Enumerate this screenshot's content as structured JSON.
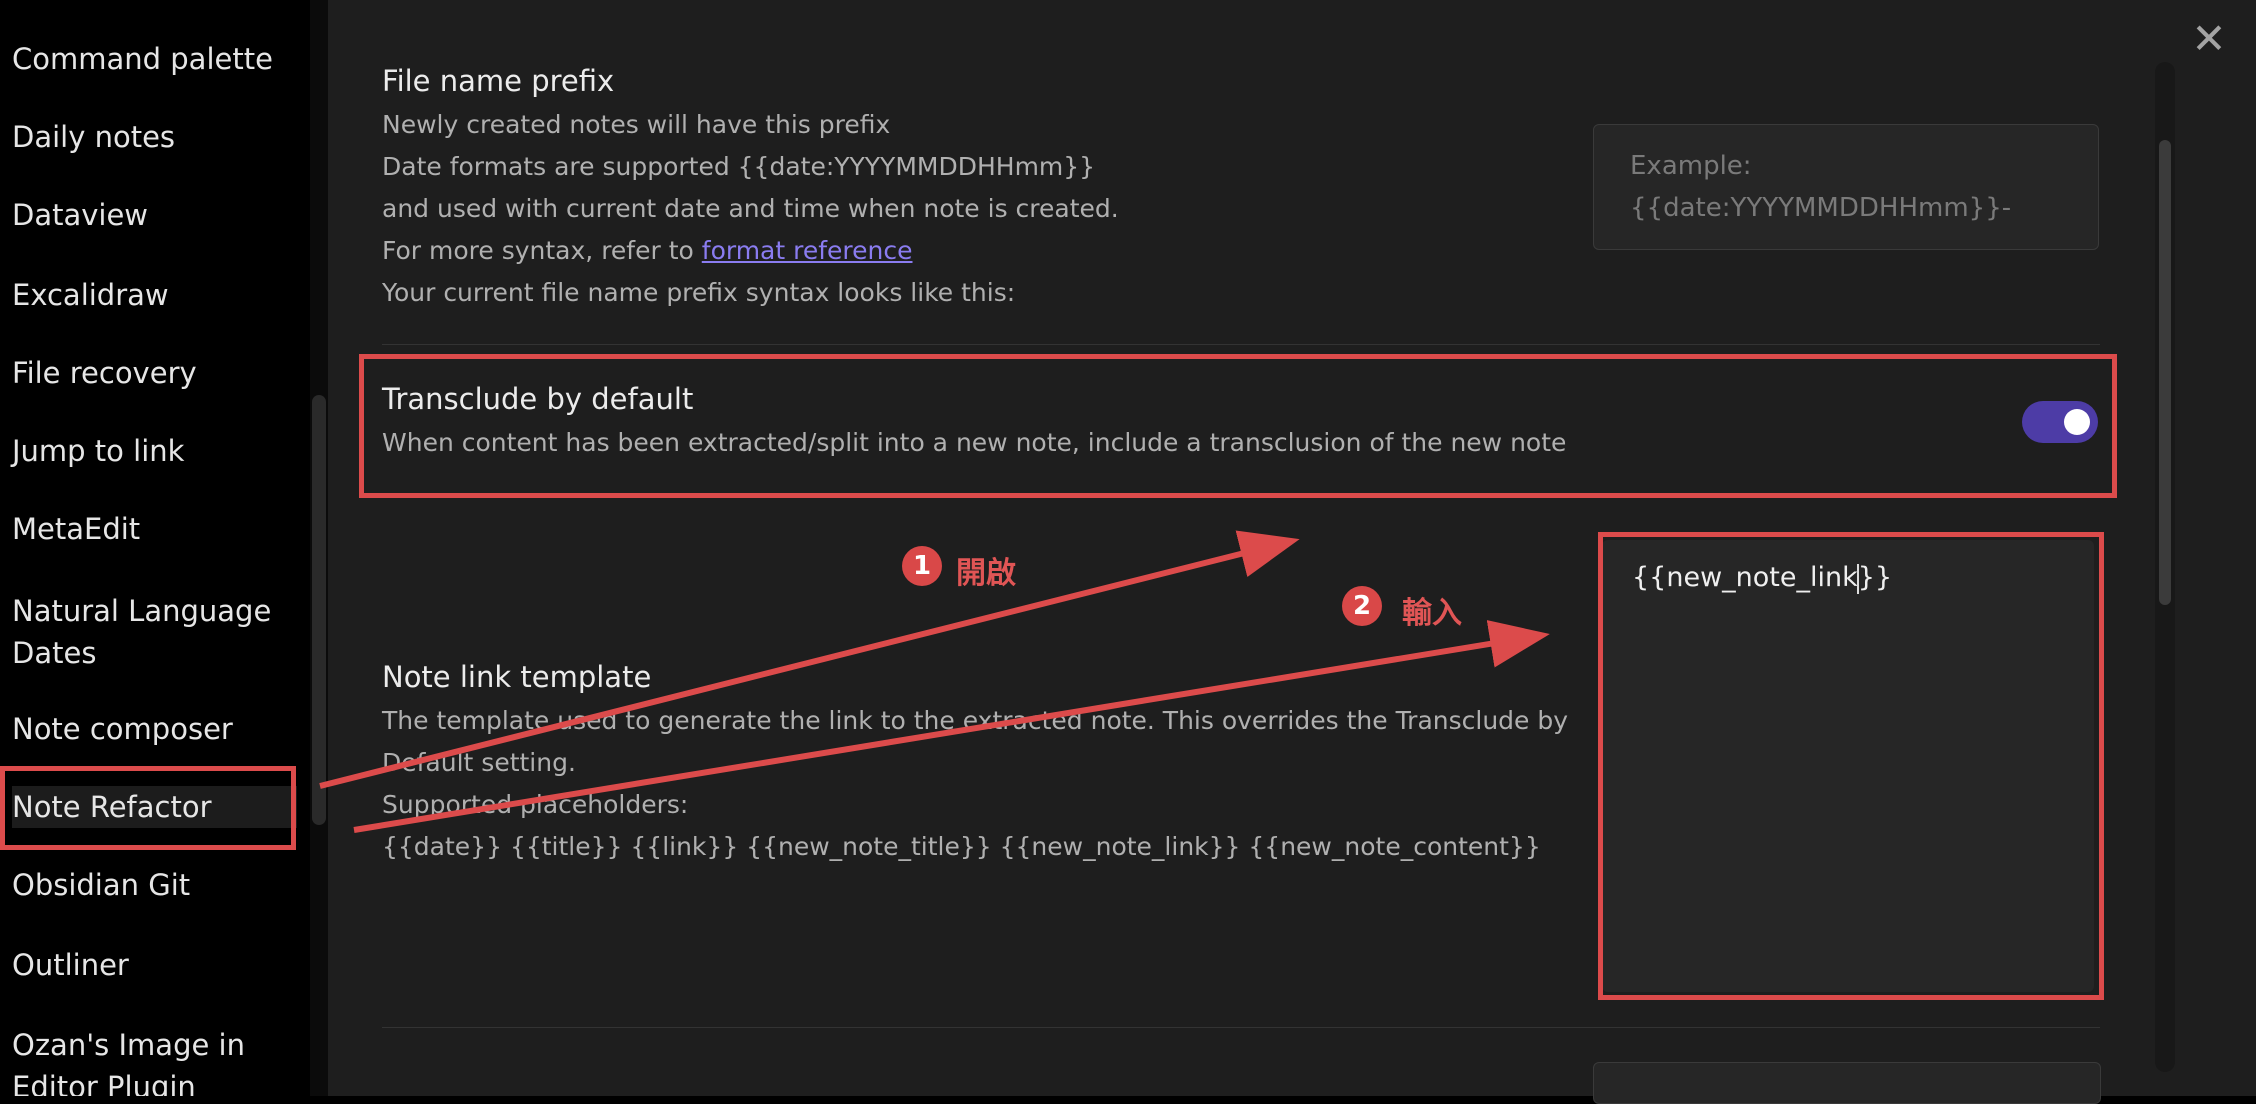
{
  "sidebar": {
    "items": [
      {
        "label": "Command palette"
      },
      {
        "label": "Daily notes"
      },
      {
        "label": "Dataview"
      },
      {
        "label": "Excalidraw"
      },
      {
        "label": "File recovery"
      },
      {
        "label": "Jump to link"
      },
      {
        "label": "MetaEdit"
      },
      {
        "label": "Natural Language Dates"
      },
      {
        "label": "Note composer"
      },
      {
        "label": "Note Refactor"
      },
      {
        "label": "Obsidian Git"
      },
      {
        "label": "Outliner"
      },
      {
        "label": "Ozan's Image in Editor Plugin"
      }
    ]
  },
  "settings": {
    "file_name_prefix": {
      "name": "File name prefix",
      "desc_lines": [
        "Newly created notes will have this prefix",
        "Date formats are supported {{date:YYYYMMDDHHmm}}",
        "and used with current date and time when note is created."
      ],
      "syntax_prefix": "For more syntax, refer to ",
      "syntax_link": "format reference",
      "current_syntax": "Your current file name prefix syntax looks like this:",
      "placeholder_line1": "Example:",
      "placeholder_line2": "{{date:YYYYMMDDHHmm}}-"
    },
    "transclude": {
      "name": "Transclude by default",
      "desc": "When content has been extracted/split into a new note, include a transclusion of the new note",
      "enabled": true
    },
    "note_link_template": {
      "name": "Note link template",
      "desc_line1": "The template used to generate the link to the extracted note. This overrides the Transclude by",
      "desc_line2": "Default setting.",
      "supported_label": "Supported placeholders:",
      "placeholders": "{{date}} {{title}} {{link}} {{new_note_title}} {{new_note_link}} {{new_note_content}}",
      "value_before_caret": "{{new_note_link",
      "value_after_caret": "}}"
    }
  },
  "annotations": {
    "step1": {
      "number": "1",
      "label": "開啟"
    },
    "step2": {
      "number": "2",
      "label": "輸入"
    },
    "color": "#dc4b4b"
  },
  "close_icon": "close-icon",
  "colors": {
    "accent": "#4d3ca6",
    "link": "#8a7cf0",
    "highlight": "#dc4b4b"
  }
}
